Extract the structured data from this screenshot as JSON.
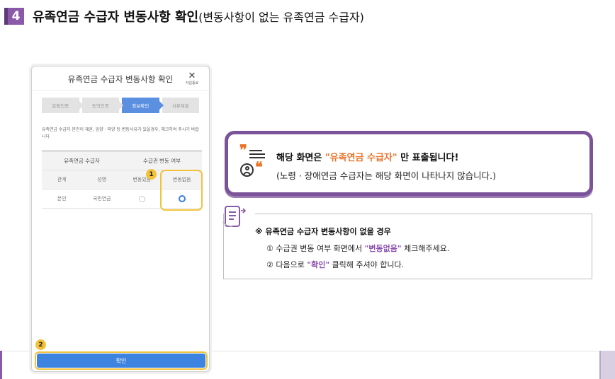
{
  "header": {
    "step_number": "4",
    "title_bold": "유족연금 수급자 변동사항 확인",
    "title_paren": "(변동사항이 없는 유족연금 수급자)"
  },
  "colors": {
    "accent_purple": "#8a5aa8",
    "highlight_yellow": "#f3c23b",
    "button_blue": "#3d84e0",
    "orange": "#e9752b"
  },
  "phone": {
    "title": "유족연금 수급자 변동사항 확인",
    "close_icon": "close-icon",
    "close_label": "작업종료",
    "steps": [
      {
        "label": "알림인증",
        "active": false
      },
      {
        "label": "동의인증",
        "active": false
      },
      {
        "label": "정보확인",
        "active": true
      },
      {
        "label": "서류제출",
        "active": false
      }
    ],
    "notice": "유족연금 수급자 본인이 재혼, 입양 · 파양 등 변동사유가 있을경우, 체크하여 주시기 바랍니다",
    "table": {
      "group_headers": [
        "유족연금 수급자",
        "수급권 변동 여부"
      ],
      "sub_headers": [
        "관계",
        "성명",
        "변동있음",
        "변동없음"
      ],
      "rows": [
        {
          "relation": "본인",
          "name": "국민연금",
          "changed": false,
          "unchanged": true
        }
      ]
    },
    "badge_1": "1",
    "badge_2": "2",
    "confirm_label": "확인"
  },
  "callout1": {
    "icon": "quote-icon",
    "person_icon": "person-icon",
    "line1_pre": "해당 화면은 ",
    "line1_highlight": "\"유족연금 수급자\"",
    "line1_post": " 만 표출됩니다!",
    "line2": "(노령 · 장애연금 수급자는 해당 화면이 나타나지 않습니다.)"
  },
  "callout2": {
    "icon": "memo-icon",
    "title": "※ 유족연금 수급자 변동사항이 없을 경우",
    "item1_pre": "① 수급권 변동 여부 화면에서 ",
    "item1_highlight": "\"변동없음\"",
    "item1_post": " 체크해주세요.",
    "item2_pre": "② 다음으로 ",
    "item2_highlight": "\"확인\"",
    "item2_post": " 클릭해 주셔야 합니다."
  }
}
